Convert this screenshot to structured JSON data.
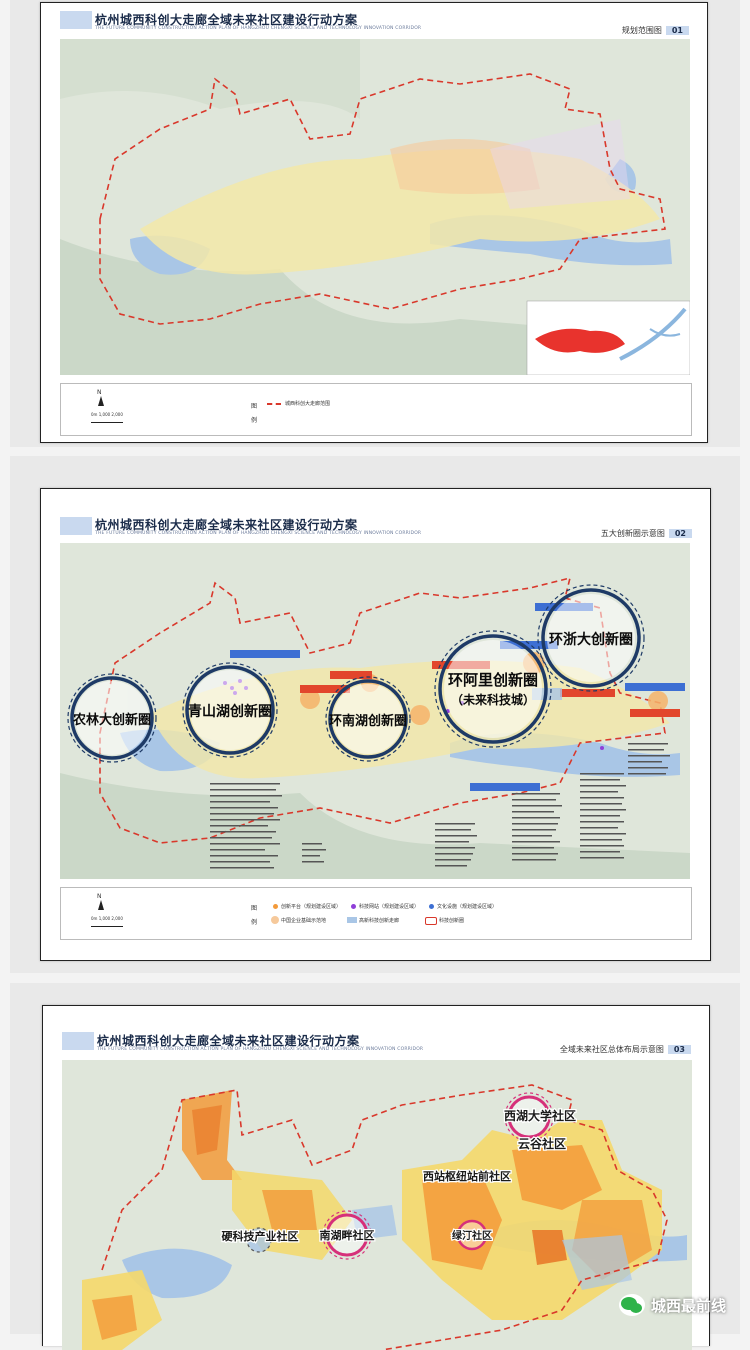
{
  "doc_title": "杭州城西科创大走廊全域未来社区建设行动方案",
  "doc_subtitle": "THE FUTURE COMMUNITY CONSTRUCTION ACTION PLAN OF HANGZHOU CHENGXI SCIENCE AND TECHNOLOGY INNOVATION CORRIDOR",
  "sheets": [
    {
      "label": "规划范围图",
      "num": "01",
      "legend_title": "图例",
      "legend_items": [
        "城西科创大走廊范围"
      ]
    },
    {
      "label": "五大创新圈示意图",
      "num": "02",
      "legend_title": "图例",
      "legend_items": [
        "创新平台（规划建设区域）",
        "科技网站（规划建设区域）",
        "文化设施（规划建设区域）",
        "中国企业基础示范地",
        "高新科技创新走廊",
        "科技创新圈"
      ]
    },
    {
      "label": "全域未来社区总体布局示意图",
      "num": "03"
    }
  ],
  "circles_sheet2": [
    {
      "name": "农林大创新圈"
    },
    {
      "name": "青山湖创新圈"
    },
    {
      "name": "环南湖创新圈"
    },
    {
      "name": "环阿里创新圈",
      "sub": "（未来科技城）"
    },
    {
      "name": "环浙大创新圈"
    }
  ],
  "labels_sheet3": [
    "西湖大学社区",
    "云谷社区",
    "西站枢纽站前社区",
    "硬科技产业社区",
    "南湖畔社区",
    "绿汀社区"
  ],
  "scale_text": "0m 1,000 2,000",
  "north": "N",
  "watermark": "城西最前线",
  "colors": {
    "boundary": "#d9382b",
    "circle": "#1e3a66",
    "orange": "#f39a3a",
    "yellow": "#f5d86a",
    "blue": "#a7c7ec",
    "pink": "#d6307a"
  }
}
